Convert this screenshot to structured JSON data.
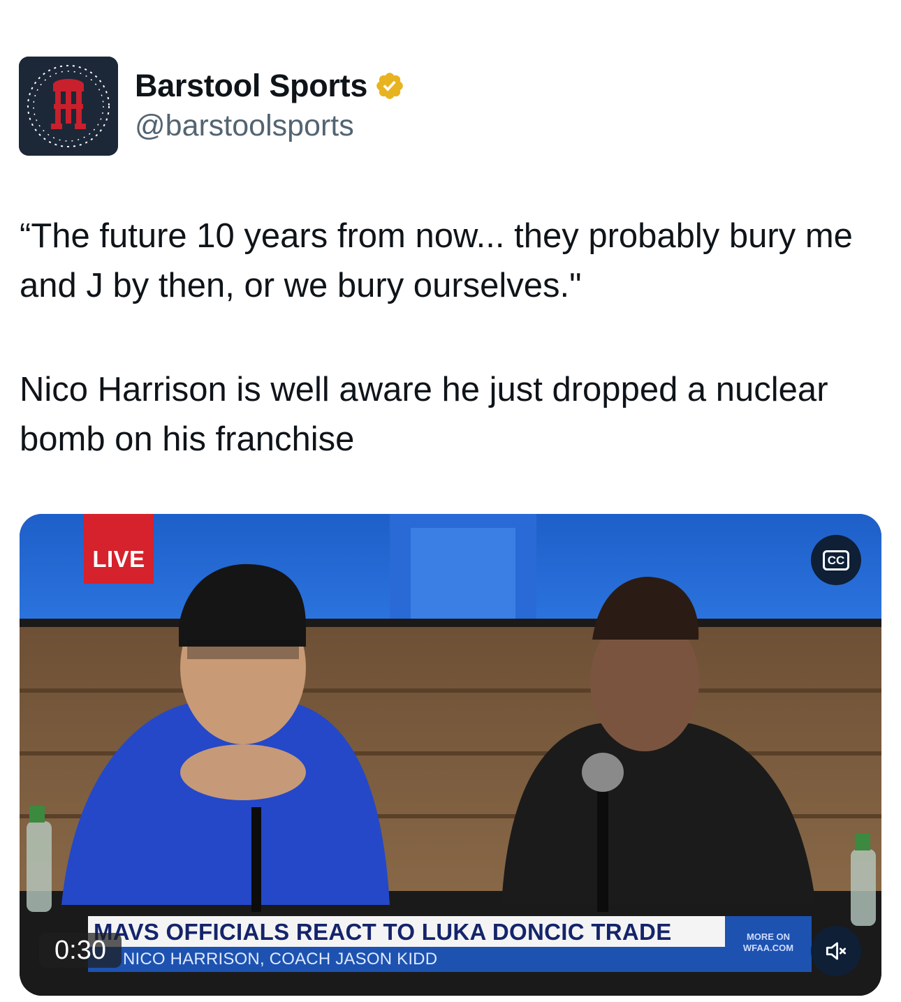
{
  "author": {
    "display_name": "Barstool Sports",
    "handle": "@barstoolsports",
    "verified": true,
    "avatar_icon": "barstool-logo-icon",
    "avatar_color": "#1c2837"
  },
  "tweet": {
    "paragraphs": [
      "“The future 10 years from now... they probably bury me and J by then, or we bury ourselves.\"",
      "Nico Harrison is well aware he just dropped a nuclear bomb on his franchise"
    ]
  },
  "video": {
    "live_label": "LIVE",
    "cc_label": "CC",
    "headline": "MAVS OFFICIALS REACT TO LUKA DONCIC TRADE",
    "subheadline": "NICO HARRISON, COACH JASON KIDD",
    "more_label_1": "MORE ON",
    "more_label_2": "WFAA.COM",
    "duration": "0:30",
    "muted": true,
    "colors": {
      "live_badge": "#d5222c",
      "headline_band": "#f4f4f4",
      "sub_band": "#1d52b0"
    }
  }
}
